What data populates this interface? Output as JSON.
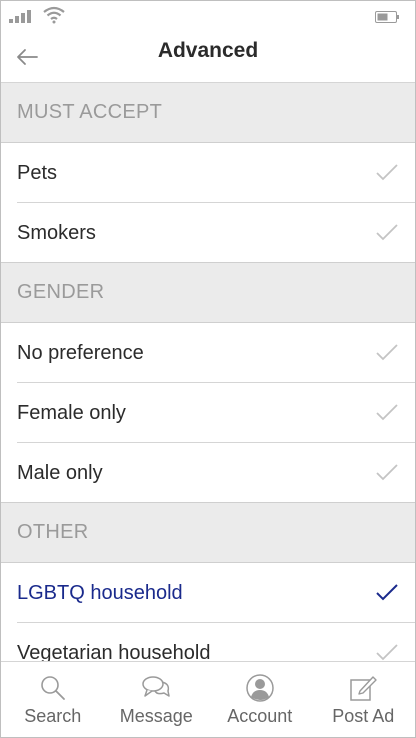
{
  "header": {
    "title": "Advanced"
  },
  "sections": [
    {
      "heading": "MUST ACCEPT",
      "items": [
        {
          "label": "Pets",
          "checked": false
        },
        {
          "label": "Smokers",
          "checked": false
        }
      ]
    },
    {
      "heading": "GENDER",
      "items": [
        {
          "label": "No preference",
          "checked": false
        },
        {
          "label": "Female only",
          "checked": false
        },
        {
          "label": "Male only",
          "checked": false
        }
      ]
    },
    {
      "heading": "OTHER",
      "items": [
        {
          "label": "LGBTQ household",
          "checked": true
        },
        {
          "label": "Vegetarian household",
          "checked": false
        }
      ]
    }
  ],
  "tabs": [
    {
      "label": "Search",
      "icon": "search-icon"
    },
    {
      "label": "Message",
      "icon": "message-icon"
    },
    {
      "label": "Account",
      "icon": "account-icon"
    },
    {
      "label": "Post Ad",
      "icon": "post-ad-icon"
    }
  ],
  "colors": {
    "accent": "#1a2a8c",
    "check_inactive": "#c4c4c4",
    "section_bg": "#ebebeb",
    "section_text": "#9a9a9a"
  }
}
